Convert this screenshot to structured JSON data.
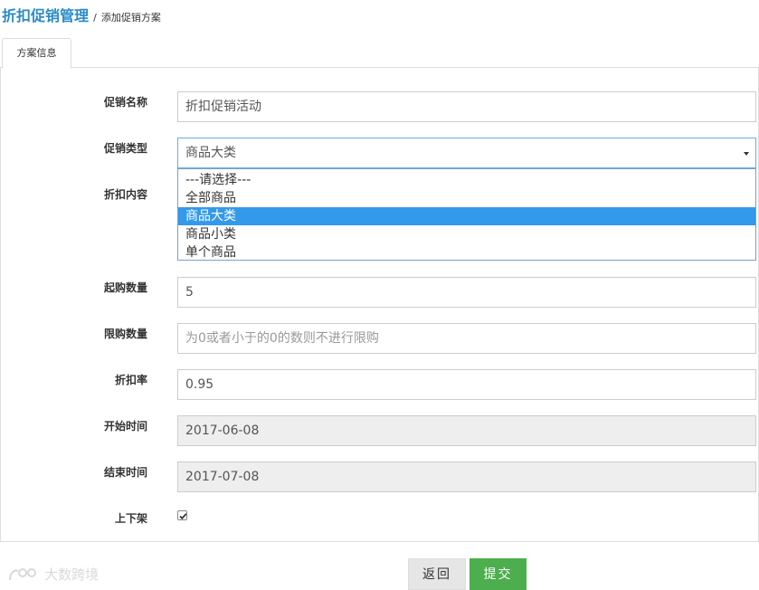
{
  "header": {
    "title": "折扣促销管理",
    "separator": "/",
    "breadcrumb": "添加促销方案"
  },
  "tabs": [
    {
      "label": "方案信息"
    }
  ],
  "form": {
    "promo_name": {
      "label": "促销名称",
      "value": "折扣促销活动"
    },
    "promo_type": {
      "label": "促销类型",
      "value": "商品大类",
      "options": [
        "---请选择---",
        "全部商品",
        "商品大类",
        "商品小类",
        "单个商品"
      ],
      "highlighted": "商品大类"
    },
    "discount_content": {
      "label": "折扣内容"
    },
    "min_qty": {
      "label": "起购数量",
      "value": "5"
    },
    "max_qty": {
      "label": "限购数量",
      "placeholder": "为0或者小于的0的数则不进行限购"
    },
    "discount_rate": {
      "label": "折扣率",
      "value": "0.95"
    },
    "start_time": {
      "label": "开始时间",
      "value": "2017-06-08"
    },
    "end_time": {
      "label": "结束时间",
      "value": "2017-07-08"
    },
    "on_shelf": {
      "label": "上下架",
      "checked": true
    }
  },
  "buttons": {
    "back": "返回",
    "submit": "提交"
  },
  "watermark": {
    "text": "大数跨境"
  },
  "colors": {
    "title": "#2a8bc7",
    "highlight": "#3399ea",
    "submit": "#4cae4c"
  }
}
